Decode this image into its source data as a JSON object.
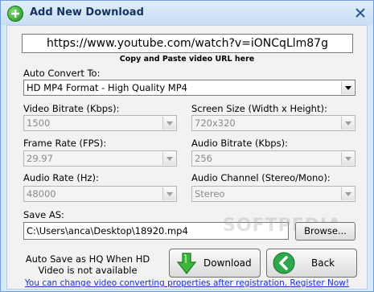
{
  "window": {
    "title": "Add New Download"
  },
  "url": {
    "value": "https://www.youtube.com/watch?v=iONCqLlm87g",
    "hint": "Copy and Paste video URL here"
  },
  "auto_convert": {
    "label": "Auto Convert To:",
    "value": "HD MP4 Format - High Quality MP4"
  },
  "video_bitrate": {
    "label": "Video Bitrate (Kbps):",
    "value": "1500"
  },
  "screen_size": {
    "label": "Screen Size (Width x Height):",
    "value": "720x320"
  },
  "frame_rate": {
    "label": "Frame Rate (FPS):",
    "value": "29.97"
  },
  "audio_bitrate": {
    "label": "Audio Bitrate (Kbps):",
    "value": "256"
  },
  "audio_rate": {
    "label": "Audio Rate (Hz):",
    "value": "48000"
  },
  "audio_channel": {
    "label": "Audio Channel (Stereo/Mono):",
    "value": "Stereo"
  },
  "save_as": {
    "label": "Save AS:",
    "value": "C:\\Users\\anca\\Desktop\\18920.mp4",
    "browse_label": "Browse..."
  },
  "autosave_note": {
    "line1": "Auto Save as HQ When HD",
    "line2": "Video is not available"
  },
  "buttons": {
    "download": "Download",
    "back": "Back"
  },
  "register_link": "You can change video converting properties after registration. Register Now!",
  "watermark": "SOFTPEDIA",
  "colors": {
    "title_text": "#15315f",
    "link": "#1a2fd6",
    "download_arrow": "#3db53d",
    "back_circle": "#2ea84a"
  }
}
